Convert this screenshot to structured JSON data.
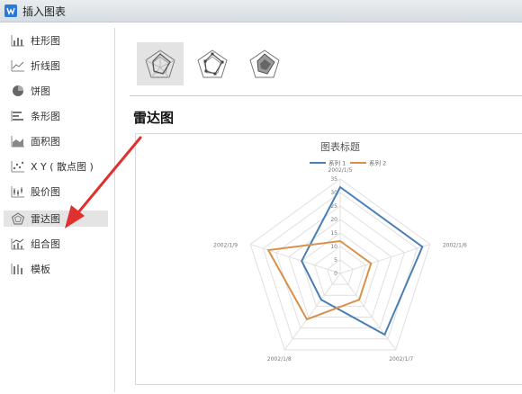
{
  "window": {
    "title": "插入图表"
  },
  "sidebar": {
    "items": [
      {
        "label": "柱形图",
        "icon": "column-chart-icon"
      },
      {
        "label": "折线图",
        "icon": "line-chart-icon"
      },
      {
        "label": "饼图",
        "icon": "pie-chart-icon"
      },
      {
        "label": "条形图",
        "icon": "bar-chart-icon"
      },
      {
        "label": "面积图",
        "icon": "area-chart-icon"
      },
      {
        "label": "X Y ( 散点图 )",
        "icon": "scatter-chart-icon"
      },
      {
        "label": "股价图",
        "icon": "stock-chart-icon"
      },
      {
        "label": "雷达图",
        "icon": "radar-chart-icon",
        "active": true
      },
      {
        "label": "组合图",
        "icon": "combo-chart-icon"
      },
      {
        "label": "模板",
        "icon": "template-icon"
      }
    ]
  },
  "subtypes": [
    {
      "icon": "radar-basic-icon",
      "selected": true
    },
    {
      "icon": "radar-markers-icon",
      "selected": false
    },
    {
      "icon": "radar-filled-icon",
      "selected": false
    }
  ],
  "main": {
    "section_title": "雷达图"
  },
  "annotation": {
    "arrow_color": "#e03030"
  },
  "chart_data": {
    "type": "radar",
    "title": "图表标题",
    "categories": [
      "2002/1/5",
      "2002/1/6",
      "2002/1/7",
      "2002/1/8",
      "2002/1/9"
    ],
    "series": [
      {
        "name": "系列 1",
        "values": [
          32,
          32,
          28,
          12,
          15
        ],
        "color": "#4a7fb5"
      },
      {
        "name": "系列 2",
        "values": [
          12,
          12,
          12,
          21,
          28
        ],
        "color": "#d9914a"
      }
    ],
    "rlim": [
      0,
      35
    ],
    "ticks": [
      "0",
      "5",
      "10",
      "15",
      "20",
      "25",
      "30",
      "35"
    ],
    "legend": "top",
    "grid": true
  }
}
